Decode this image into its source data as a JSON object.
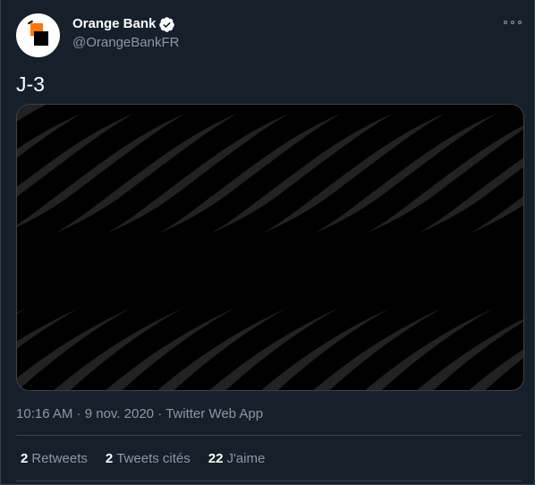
{
  "author": {
    "display_name": "Orange Bank",
    "handle": "@OrangeBankFR",
    "verified": true,
    "avatar_icon": "orange-bank-logo-icon"
  },
  "tweet": {
    "text": "J-3"
  },
  "meta": {
    "time": "10:16 AM",
    "separator1": " · ",
    "date": "9 nov. 2020",
    "separator2": " · ",
    "source": "Twitter Web App"
  },
  "stats": [
    {
      "count": "2",
      "label": "Retweets"
    },
    {
      "count": "2",
      "label": "Tweets cités"
    },
    {
      "count": "22",
      "label": "J'aime"
    }
  ],
  "colors": {
    "background": "#15202b",
    "border": "#38444d",
    "secondary_text": "#8899a6",
    "primary_text": "#ffffff",
    "brand_orange": "#ff7900",
    "media_stripe_light": "#222222",
    "media_stripe_dark": "#000000"
  }
}
